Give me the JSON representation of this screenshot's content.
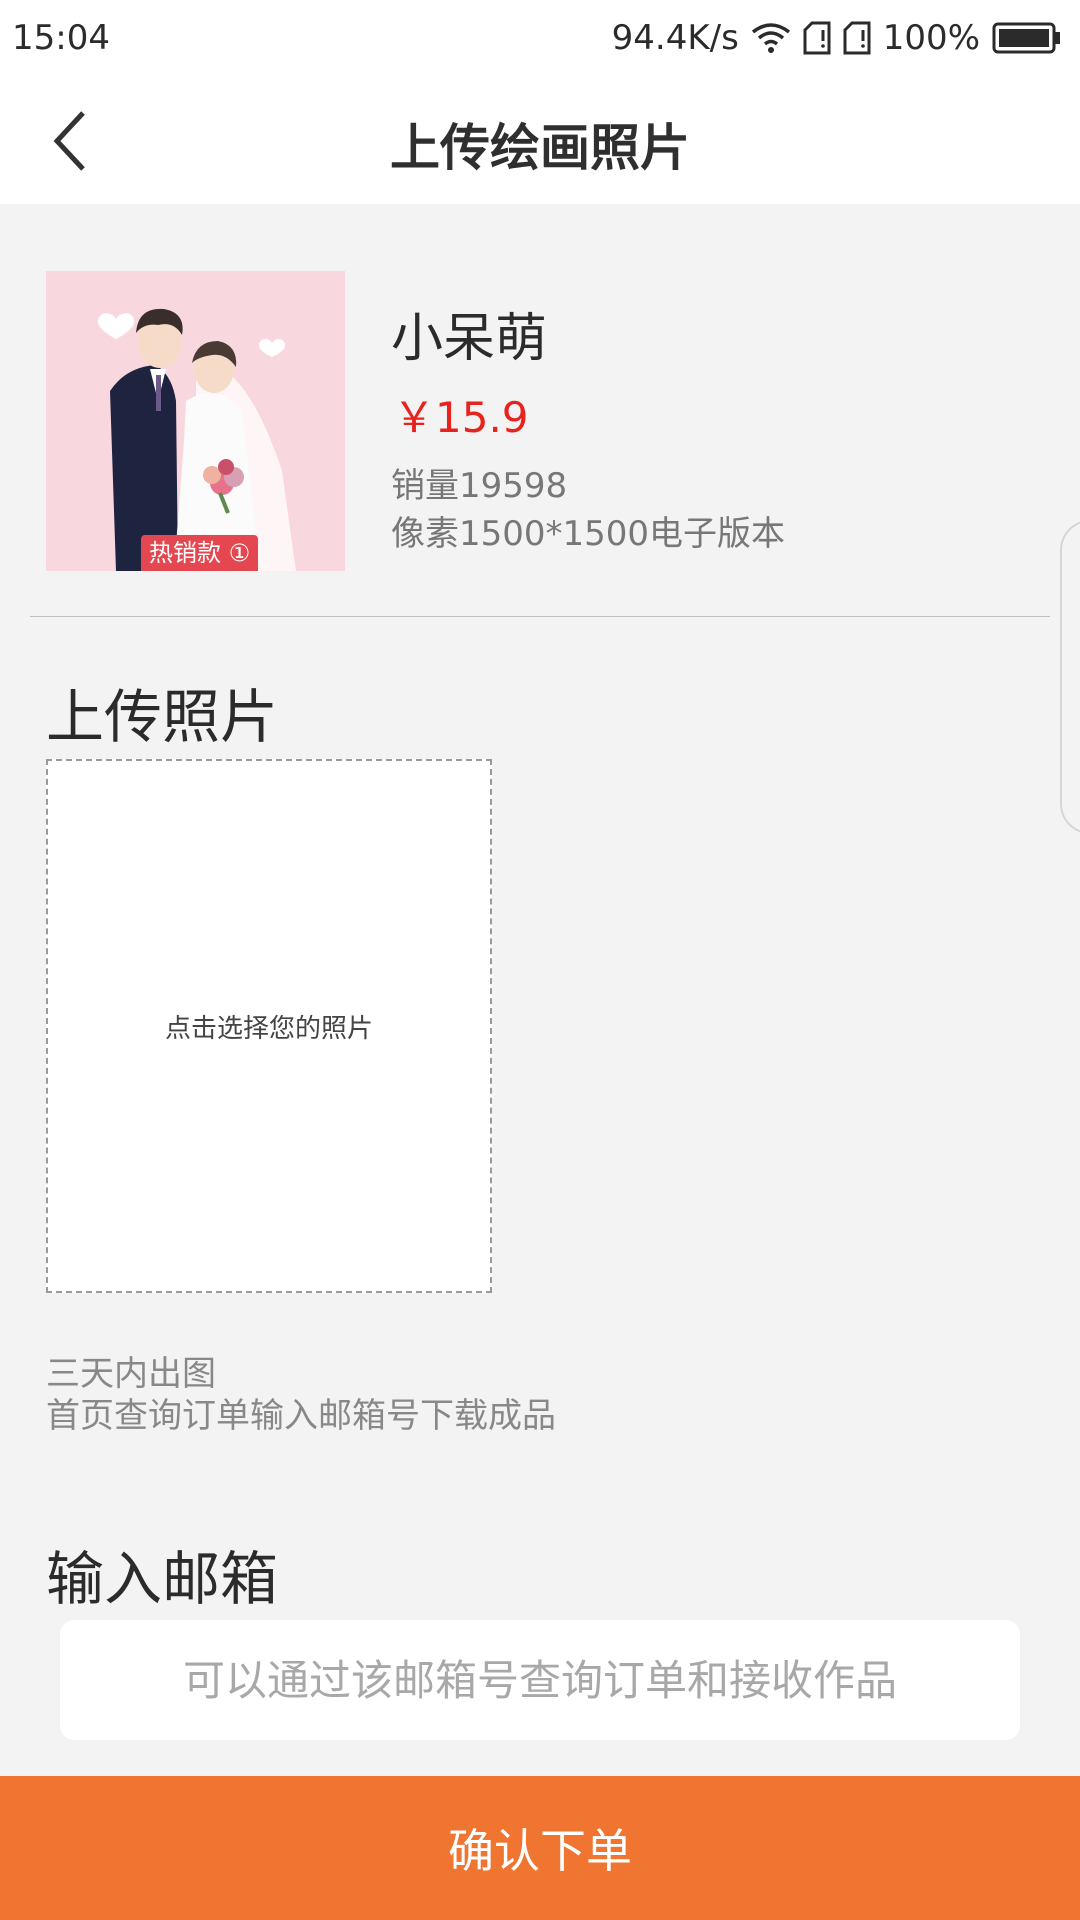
{
  "status_bar": {
    "time": "15:04",
    "network_speed": "94.4K/s",
    "battery": "100%",
    "icons": [
      "wifi-icon",
      "sim-card-icon",
      "sim-card-icon",
      "battery-icon"
    ]
  },
  "nav": {
    "back_icon": "chevron-left-icon",
    "title": "上传绘画照片"
  },
  "product": {
    "badge": "热销款 ①",
    "name": "小呆萌",
    "price": "￥15.9",
    "sales": "销量19598",
    "spec": "像素1500*1500电子版本"
  },
  "upload": {
    "title": "上传照片",
    "hint": "点击选择您的照片",
    "note_line1": "三天内出图",
    "note_line2": "首页查询订单输入邮箱号下载成品"
  },
  "email": {
    "title": "输入邮箱",
    "value": "",
    "placeholder": "可以通过该邮箱号查询订单和接收作品"
  },
  "footer": {
    "confirm_label": "确认下单"
  },
  "colors": {
    "accent": "#ef7531",
    "price": "#e8231d",
    "background": "#f3f3f3"
  }
}
